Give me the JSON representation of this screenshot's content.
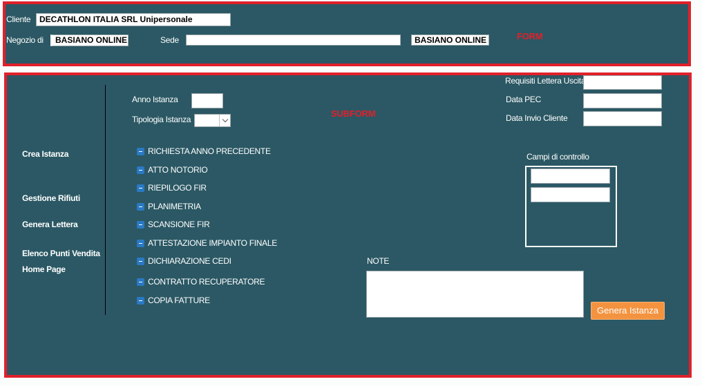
{
  "form": {
    "tag": "FORM",
    "cliente_label": "Cliente",
    "cliente_value": "DECATHLON ITALIA SRL Unipersonale",
    "negozio_label": "Negozio di",
    "negozio_value": "BASIANO ONLINE",
    "sede_label": "Sede",
    "sede_value": "",
    "sede_name_value": "BASIANO ONLINE"
  },
  "subform": {
    "tag": "SUBFORM",
    "nav": [
      "Crea Istanza",
      "Gestione Rifiuti",
      "Genera Lettera",
      "Elenco Punti Vendita",
      "Home Page"
    ],
    "anno_label": "Anno Istanza",
    "tipologia_label": "Tipologia Istanza",
    "requisiti_label": "Requisiti Lettera Uscita",
    "data_pec_label": "Data PEC",
    "data_invio_label": "Data Invio Cliente",
    "campi_label": "Campi di controllo",
    "checklist": [
      "RICHIESTA ANNO PRECEDENTE",
      "ATTO NOTORIO",
      "RIEPILOGO FIR",
      "PLANIMETRIA",
      "SCANSIONE FIR",
      "ATTESTAZIONE IMPIANTO FINALE",
      "DICHIARAZIONE CEDI",
      "CONTRATTO RECUPERATORE",
      "COPIA FATTURE"
    ],
    "note_label": "NOTE",
    "genera_button": "Genera Istanza"
  },
  "colors": {
    "panel": "#2b5864",
    "border": "#e0202b",
    "button": "#f4933f",
    "check_icon": "#2a79c4"
  }
}
